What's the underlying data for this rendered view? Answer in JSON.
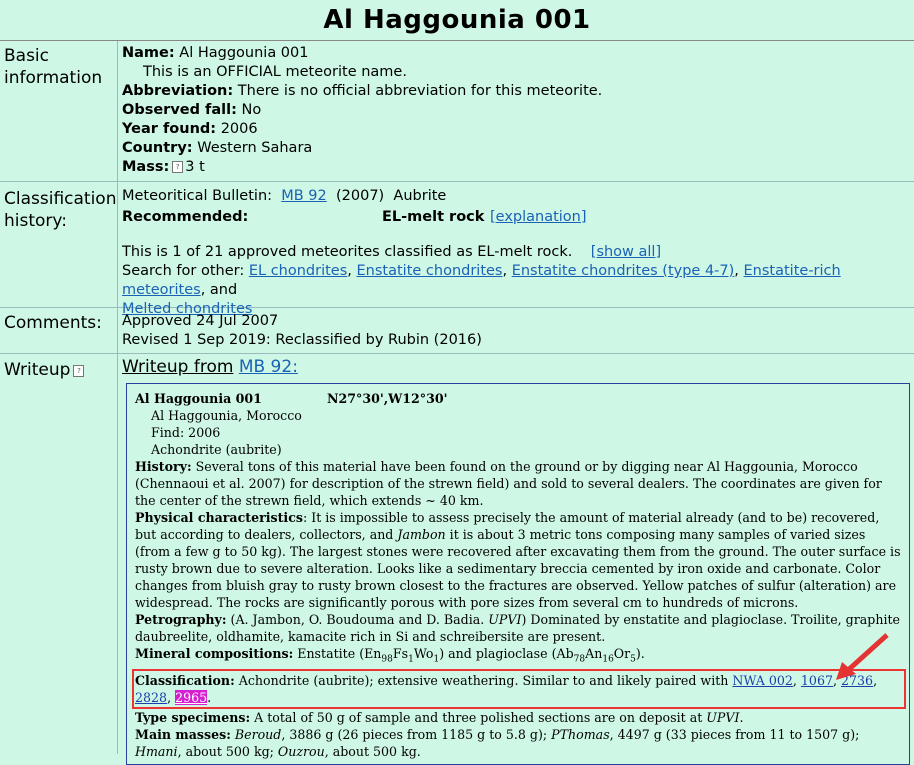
{
  "title": "Al Haggounia 001",
  "basic": {
    "label": "Basic information",
    "name_label": "Name:",
    "name": "Al Haggounia 001",
    "official": "This is an OFFICIAL meteorite name.",
    "abbrev_label": "Abbreviation:",
    "abbrev": "There is no official abbreviation for this meteorite.",
    "fall_label": "Observed fall:",
    "fall": "No",
    "year_label": "Year found:",
    "year": "2006",
    "country_label": "Country:",
    "country": "Western Sahara",
    "mass_label": "Mass:",
    "mass": "3 t"
  },
  "classification": {
    "label": "Classification history:",
    "bulletin_label": "Meteoritical Bulletin:",
    "bulletin_link": "MB 92",
    "bulletin_year": "(2007)",
    "bulletin_class": "Aubrite",
    "recommended_label": "Recommended:",
    "recommended": "EL-melt rock",
    "explanation": "[explanation]",
    "approved_text": "This is 1 of 21 approved meteorites classified as EL-melt rock.",
    "show_all": "[show all]",
    "search_label": "Search for other:",
    "search_links": [
      "EL chondrites",
      "Enstatite chondrites",
      "Enstatite chondrites (type 4-7)",
      "Enstatite-rich meteorites"
    ],
    "search_and": "and",
    "search_last": "Melted chondrites"
  },
  "comments": {
    "label": "Comments:",
    "line1": "Approved 24 Jul 2007",
    "line2": "Revised 1 Sep 2019: Reclassified by Rubin (2016)"
  },
  "writeup": {
    "label": "Writeup",
    "heading": "Writeup from",
    "heading_link": "MB 92:",
    "name": "Al Haggounia 001",
    "coords": "N27°30',W12°30'",
    "location": "Al Haggounia, Morocco",
    "find": "Find: 2006",
    "type": "Achondrite (aubrite)",
    "history_label": "History:",
    "history": "Several tons of this material have been found on the ground or by digging near Al Haggounia, Morocco (Chennaoui et al. 2007) for description of the strewn field) and sold to several dealers. The coordinates are given for the center of the strewn field, which extends ~ 40 km.",
    "physical_label": "Physical characteristics",
    "physical_a": ": It is impossible to assess precisely the amount of material already (and to be) recovered, but according to dealers, collectors, and",
    "physical_italic": "Jambon",
    "physical_b": "it is about 3 metric tons composing many samples of varied sizes (from a few g to 50 kg). The largest stones were recovered after excavating them from the ground. The outer surface is rusty brown due to severe alteration. Looks like a sedimentary breccia cemented by iron oxide and carbonate. Color changes from bluish gray to rusty brown closest to the fractures are observed. Yellow patches of sulfur (alteration) are widespread. The rocks are significantly porous with pore sizes from several cm to hundreds of microns.",
    "petro_label": "Petrography:",
    "petro_a": "(A. Jambon, O. Boudouma and D. Badia.",
    "petro_italic": "UPVI",
    "petro_b": ") Dominated by enstatite and plagioclase. Troilite, graphite daubreelite, oldhamite, kamacite rich in Si and schreibersite are present.",
    "mineral_label": "Mineral compositions:",
    "mineral_a": "Enstatite (En",
    "mineral_en": "98",
    "mineral_fs_t": "Fs",
    "mineral_fs": "1",
    "mineral_wo_t": "Wo",
    "mineral_wo": "1",
    "mineral_b": ") and plagioclase (Ab",
    "mineral_ab": "78",
    "mineral_an_t": "An",
    "mineral_an": "16",
    "mineral_or_t": "Or",
    "mineral_or": "5",
    "mineral_c": ").",
    "class_label": "Classification:",
    "class_text": "Achondrite (aubrite); extensive weathering. Similar to and likely paired with",
    "class_links": [
      "NWA 002",
      "1067",
      "2736",
      "2828"
    ],
    "class_highlight": "2965",
    "type_label": "Type specimens:",
    "type_text": "A total of 50 g of sample and three polished sections are on deposit at",
    "type_italic": "UPVI",
    "masses_label": "Main masses:",
    "masses": [
      {
        "holder": "Beroud",
        "desc": ", 3886 g (26 pieces from 1185 g to 5.8 g);"
      },
      {
        "holder": "PThomas",
        "desc": ", 4497 g (33 pieces from 11 to 1507 g);"
      },
      {
        "holder": "Hmani",
        "desc": ", about 500 kg;"
      },
      {
        "holder": "Ouzrou",
        "desc": ", about 500 kg."
      }
    ]
  },
  "colors": {
    "background": "#cff7e6",
    "link": "#1a62b5",
    "highlight": "#d51fd0",
    "annotation": "#e33333"
  }
}
